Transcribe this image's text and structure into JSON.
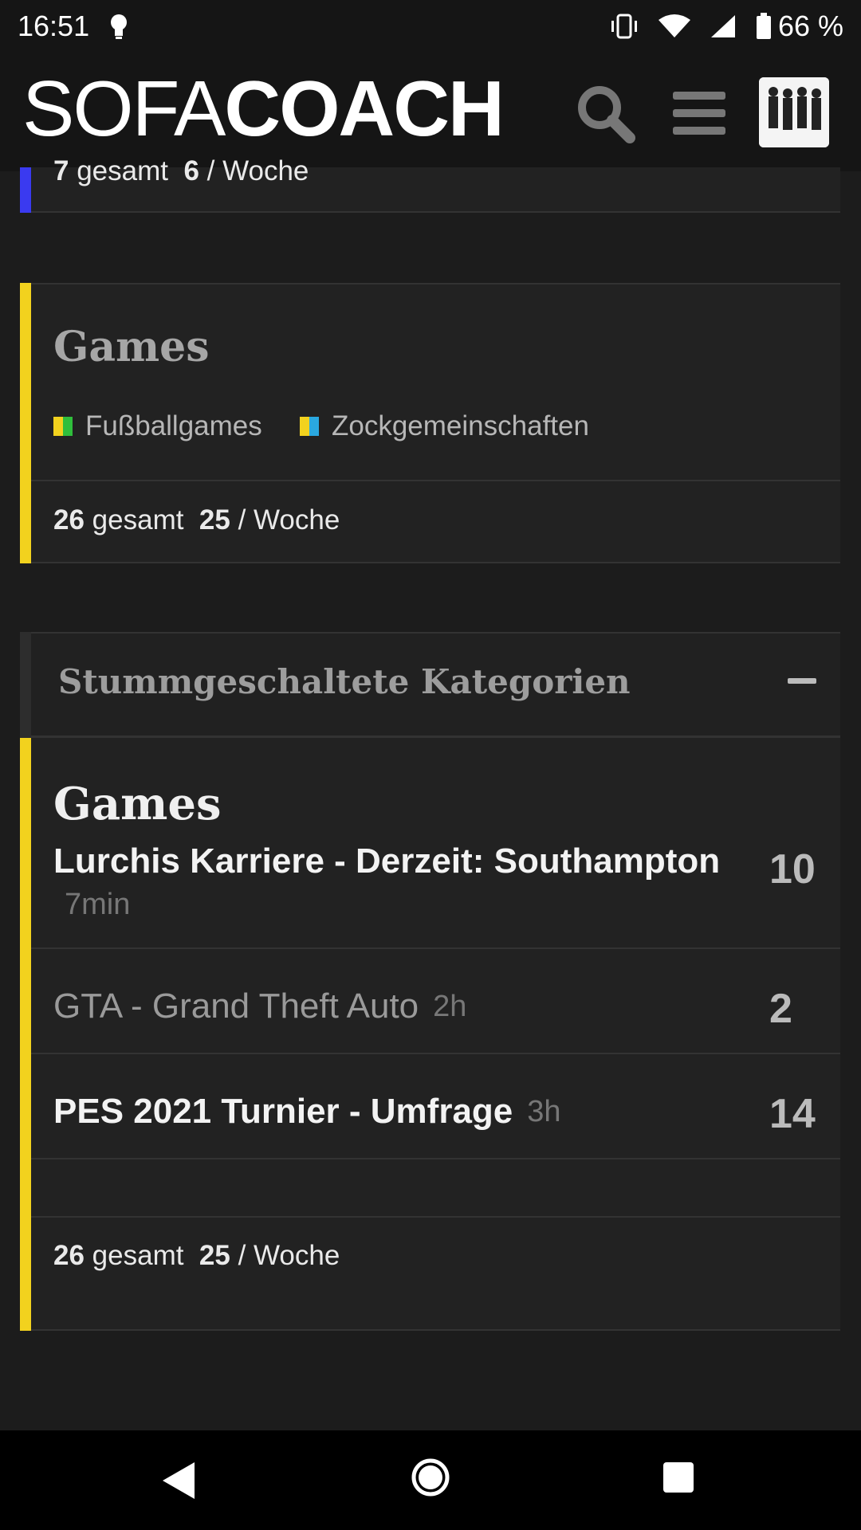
{
  "status_bar": {
    "time": "16:51",
    "battery": "66 %"
  },
  "header": {
    "logo_light": "SOFA",
    "logo_bold": "COACH",
    "icons": {
      "search": "search-icon",
      "menu": "menu-icon",
      "avatar": "avatar-image"
    }
  },
  "top_card": {
    "total": "7",
    "total_label": "gesamt",
    "per_week": "6",
    "per_week_label": "/ Woche",
    "accent": "#3a3af0"
  },
  "games_card": {
    "title": "Games",
    "accent": "#f2d21e",
    "tags": [
      {
        "label": "Fußballgames",
        "colors": [
          "#f2d21e",
          "#2fbe3c"
        ]
      },
      {
        "label": "Zockgemeinschaften",
        "colors": [
          "#f2d21e",
          "#2aa8e0"
        ]
      }
    ],
    "total": "26",
    "total_label": "gesamt",
    "per_week": "25",
    "per_week_label": "/ Woche"
  },
  "muted_section": {
    "title": "Stummgeschaltete Kategorien",
    "collapse_symbol": "–",
    "card": {
      "title": "Games",
      "threads": [
        {
          "title": "Lurchis Karriere - Derzeit: Southampton",
          "time": "7min",
          "count": "10",
          "unread": true
        },
        {
          "title": "GTA - Grand Theft Auto",
          "time": "2h",
          "count": "2",
          "unread": false
        },
        {
          "title": "PES 2021 Turnier - Umfrage",
          "time": "3h",
          "count": "14",
          "unread": true
        }
      ],
      "total": "26",
      "total_label": "gesamt",
      "per_week": "25",
      "per_week_label": "/ Woche"
    }
  }
}
